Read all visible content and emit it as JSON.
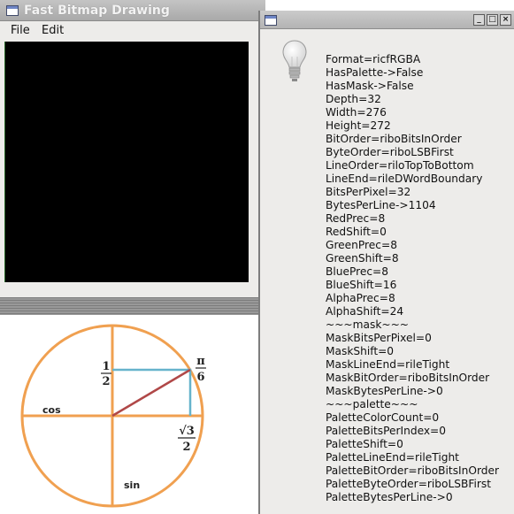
{
  "main_window": {
    "title": "Fast Bitmap Drawing",
    "menu": [
      "File",
      "Edit"
    ]
  },
  "diagram": {
    "labels": {
      "half_num": "1",
      "half_den": "2",
      "pi_num": "π",
      "pi_den": "6",
      "sqrt3_num": "√3",
      "sqrt3_den": "2",
      "cos": "cos",
      "sin": "sin"
    },
    "colors": {
      "circle": "#f0a050",
      "projection": "#66b3cc",
      "radius": "#b04848"
    }
  },
  "info_window": {
    "title": "",
    "buttons": [
      "_",
      "□",
      "×"
    ],
    "icon": "lightbulb-icon",
    "lines": [
      "Format=ricfRGBA",
      "HasPalette->False",
      "HasMask->False",
      "Depth=32",
      "Width=276",
      "Height=272",
      "BitOrder=riboBitsInOrder",
      "ByteOrder=riboLSBFirst",
      "LineOrder=riloTopToBottom",
      "LineEnd=rileDWordBoundary",
      "BitsPerPixel=32",
      "BytesPerLine->1104",
      "RedPrec=8",
      "RedShift=0",
      "GreenPrec=8",
      "GreenShift=8",
      "BluePrec=8",
      "BlueShift=16",
      "AlphaPrec=8",
      "AlphaShift=24",
      "~~~mask~~~",
      "MaskBitsPerPixel=0",
      "MaskShift=0",
      "MaskLineEnd=rileTight",
      "MaskBitOrder=riboBitsInOrder",
      "MaskBytesPerLine->0",
      "~~~palette~~~",
      "PaletteColorCount=0",
      "PaletteBitsPerIndex=0",
      "PaletteShift=0",
      "PaletteLineEnd=rileTight",
      "PaletteBitOrder=riboBitsInOrder",
      "PaletteByteOrder=riboLSBFirst",
      "PaletteBytesPerLine->0"
    ]
  }
}
